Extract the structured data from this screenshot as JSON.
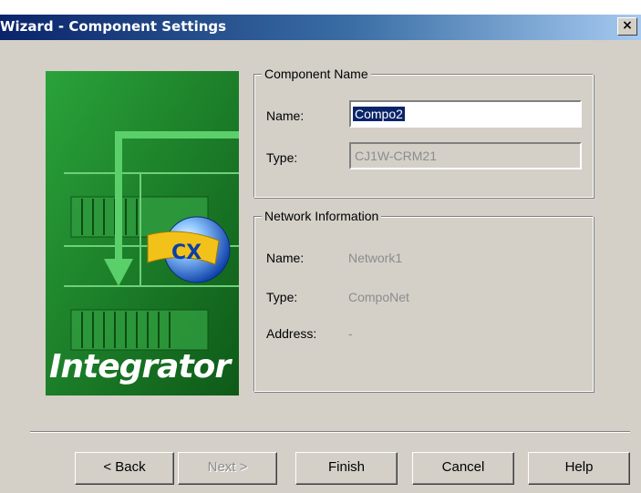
{
  "window": {
    "title": "Wizard - Component Settings",
    "close_label": "×"
  },
  "banner": {
    "logo_text": "Integrator"
  },
  "component_group": {
    "legend": "Component Name",
    "name_label": "Name:",
    "name_value": "Compo2",
    "type_label": "Type:",
    "type_value": "CJ1W-CRM21"
  },
  "network_group": {
    "legend": "Network Information",
    "name_label": "Name:",
    "name_value": "Network1",
    "type_label": "Type:",
    "type_value": "CompoNet",
    "address_label": "Address:",
    "address_value": "-"
  },
  "buttons": {
    "back": "< Back",
    "next": "Next >",
    "finish": "Finish",
    "cancel": "Cancel",
    "help": "Help"
  },
  "colors": {
    "title_bar_start": "#0a246a",
    "dialog_face": "#d4d0c8",
    "banner_green": "#1a7a24",
    "selection": "#0a246a"
  },
  "icons": {
    "close": "close-icon",
    "logo": "cx-globe-icon"
  }
}
